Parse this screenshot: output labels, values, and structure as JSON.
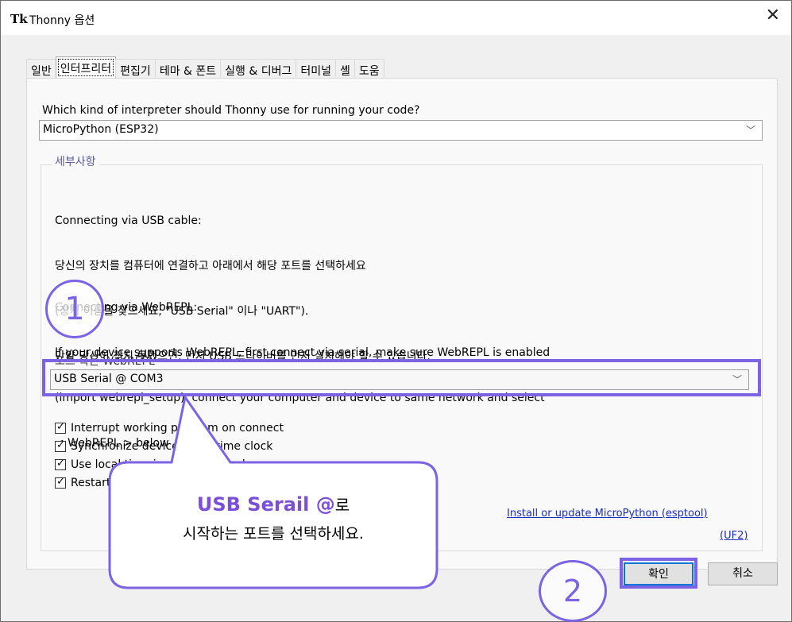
{
  "window": {
    "icon": "Tk",
    "title": "Thonny 옵션",
    "close": "✕"
  },
  "tabs": [
    "일반",
    "인터프리터",
    "편집기",
    "테마 & 폰트",
    "실행 & 디버그",
    "터미널",
    "셸",
    "도움"
  ],
  "question": "Which kind of interpreter should Thonny use for running your code?",
  "interpreter": {
    "value": "MicroPython (ESP32)"
  },
  "details_label": "세부사항",
  "usb_lines": [
    "Connecting via USB cable:",
    "당신의 장치를 컴퓨터에 연결하고 아래에서 해당 포트를 선택하세요",
    "(장치 이름을 찾으세요, \"USB Serial\" 이나 \"UART\").",
    "만약 당신이 찾지 못했으면, 먼저 USB 드라이버를 먼저 설치해야 할 수 있습니다."
  ],
  "webrepl_lines": [
    "Connecting via WebREPL:",
    "If your device supports WebREPL, first connect via serial, make sure WebREPL is enabled",
    "(import webrepl_setup), connect your computer and device to same network and select",
    "< WebREPL > below"
  ],
  "port_label": "포트 혹은 WebREPL",
  "port": {
    "value": "USB Serial @ COM3"
  },
  "checkboxes": [
    {
      "label": "Interrupt working program on connect",
      "checked": true
    },
    {
      "label": "Synchronize device's real time clock",
      "checked": true
    },
    {
      "label": "Use local time in real time clock",
      "checked": true
    },
    {
      "label": "Restart interpreter before running a script",
      "checked": true
    }
  ],
  "links": {
    "install": "Install or update MicroPython (esptool)",
    "uf2": "(UF2)"
  },
  "buttons": {
    "ok": "확인",
    "cancel": "취소"
  },
  "annotations": {
    "step1": "1",
    "step2": "2",
    "callout_title": "USB Serail @",
    "callout_suffix": "로",
    "callout_sub": "시작하는 포트를 선택하세요.",
    "accent": "#7b63e3"
  }
}
